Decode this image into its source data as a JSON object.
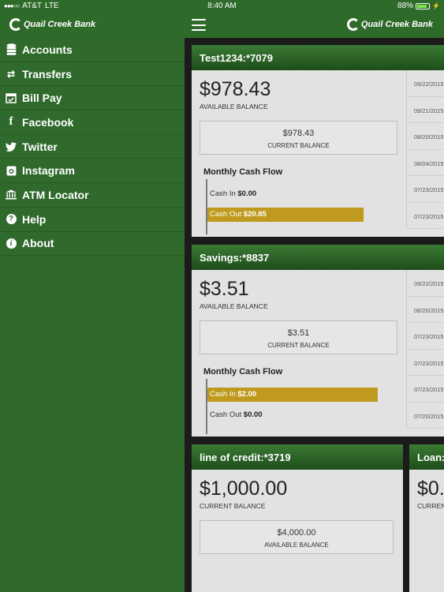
{
  "status": {
    "carrier": "AT&T",
    "network": "LTE",
    "time": "8:40 AM",
    "battery_label": "88%",
    "battery_level": 0.88
  },
  "header": {
    "logo_text": "Quail Creek Bank",
    "logo_text_right": "Quail Creek Bank",
    "menu_icon": "hamburger-icon"
  },
  "sidebar": {
    "items": [
      {
        "label": "Accounts",
        "icon": "accounts-icon"
      },
      {
        "label": "Transfers",
        "icon": "transfer-arrows-icon"
      },
      {
        "label": "Bill Pay",
        "icon": "calendar-check-icon"
      },
      {
        "label": "Facebook",
        "icon": "facebook-icon"
      },
      {
        "label": "Twitter",
        "icon": "twitter-icon"
      },
      {
        "label": "Instagram",
        "icon": "instagram-icon"
      },
      {
        "label": "ATM Locator",
        "icon": "bank-building-icon"
      },
      {
        "label": "Help",
        "icon": "question-icon"
      },
      {
        "label": "About",
        "icon": "info-icon"
      }
    ]
  },
  "accounts": [
    {
      "name": "Test1234:*7079",
      "main_balance": "$978.43",
      "main_label": "AVAILABLE BALANCE",
      "sub_balance": "$978.43",
      "sub_label": "CURRENT BALANCE",
      "flow_title": "Monthly Cash Flow",
      "cash_in_label": "Cash In",
      "cash_in": "$0.00",
      "cash_out_label": "Cash Out",
      "cash_out": "$20.85",
      "dates": [
        "09/22/2015",
        "09/21/2015",
        "08/20/2015",
        "08/04/2015",
        "07/23/2015",
        "07/23/2015"
      ]
    },
    {
      "name": "Savings:*8837",
      "main_balance": "$3.51",
      "main_label": "AVAILABLE BALANCE",
      "sub_balance": "$3.51",
      "sub_label": "CURRENT BALANCE",
      "flow_title": "Monthly Cash Flow",
      "cash_in_label": "Cash In",
      "cash_in": "$2.00",
      "cash_out_label": "Cash Out",
      "cash_out": "$0.00",
      "dates": [
        "09/22/2015",
        "08/20/2015",
        "07/23/2015",
        "07/23/2015",
        "07/23/2015",
        "07/20/2015"
      ]
    },
    {
      "name": "line of credit:*3719",
      "main_balance": "$1,000.00",
      "main_label": "CURRENT BALANCE",
      "sub_balance": "$4,000.00",
      "sub_label": "AVAILABLE BALANCE"
    },
    {
      "name": "Loan:",
      "main_balance": "$0.",
      "main_label": "CURREN"
    }
  ],
  "colors": {
    "brand_green": "#2f6a2c",
    "cash_bar": "#bf9a1e"
  }
}
